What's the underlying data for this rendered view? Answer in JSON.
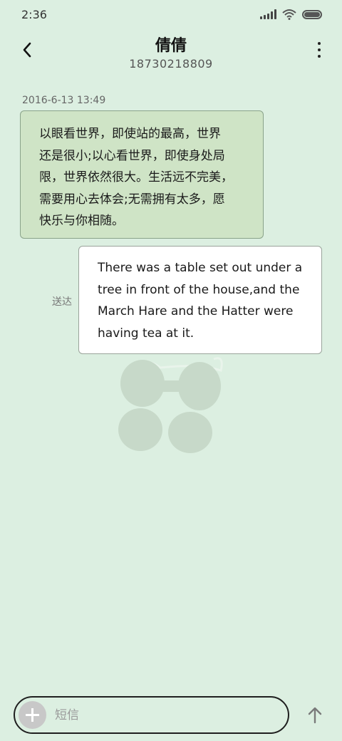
{
  "status_bar": {
    "time": "2:36"
  },
  "header": {
    "contact_name": "倩倩",
    "contact_number": "18730218809"
  },
  "messages": [
    {
      "direction": "incoming",
      "timestamp": "2016-6-13 13:49",
      "text": "以眼看世界，即使站的最高，世界\n还是很小;以心看世界，即使身处局\n限，世界依然很大。生活远不完美，\n需要用心去体会;无需拥有太多，愿\n快乐与你相随。"
    },
    {
      "direction": "outgoing",
      "status": "送达",
      "text": "There was a table set out under a tree in front of the house,and the March Hare and the Hatter were having tea at it."
    }
  ],
  "compose": {
    "placeholder": "短信",
    "value": ""
  },
  "icons": {
    "back": "back-arrow-icon",
    "more": "more-vertical-icon",
    "add": "plus-icon",
    "send": "send-arrow-up-icon",
    "signal": "cellular-signal-icon",
    "wifi": "wifi-icon",
    "battery": "battery-icon"
  },
  "colors": {
    "background": "#dcefe1",
    "incoming_bubble": "#cfe4c6",
    "outgoing_bubble": "#ffffff"
  }
}
